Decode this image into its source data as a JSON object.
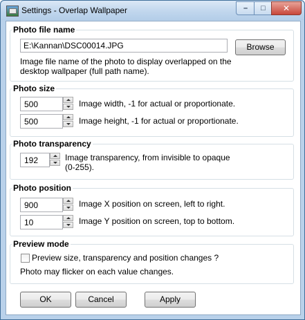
{
  "window": {
    "title": "Settings - Overlap Wallpaper",
    "minimize_glyph": "–",
    "maximize_glyph": "□",
    "close_glyph": "✕"
  },
  "photo_file": {
    "legend": "Photo file name",
    "value": "E:\\Kannan\\DSC00014.JPG",
    "browse_label": "Browse",
    "description_line1": "Image file name of the photo to display overlapped on the",
    "description_line2": "desktop wallpaper (full path name)."
  },
  "photo_size": {
    "legend": "Photo size",
    "width_value": "500",
    "width_label": "Image width, -1 for actual or proportionate.",
    "height_value": "500",
    "height_label": "Image height, -1 for actual or proportionate."
  },
  "photo_transparency": {
    "legend": "Photo transparency",
    "value": "192",
    "label_line1": "Image transparency, from invisible to opaque",
    "label_line2": "(0-255)."
  },
  "photo_position": {
    "legend": "Photo position",
    "x_value": "900",
    "x_label": "Image X position on screen, left to right.",
    "y_value": "10",
    "y_label": "Image Y position on screen, top to bottom."
  },
  "preview_mode": {
    "legend": "Preview mode",
    "checkbox_label": "Preview size, transparency and position changes ?",
    "checked": false,
    "note": "Photo may flicker on each value changes."
  },
  "buttons": {
    "ok": "OK",
    "cancel": "Cancel",
    "apply": "Apply"
  }
}
